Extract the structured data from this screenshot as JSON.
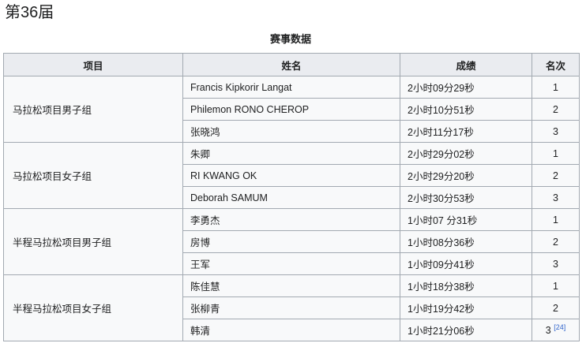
{
  "page_heading": "第36届",
  "table": {
    "caption": "赛事数据",
    "headers": [
      "项目",
      "姓名",
      "成绩",
      "名次"
    ],
    "groups": [
      {
        "event": "马拉松项目男子组",
        "rows": [
          {
            "name": "Francis Kipkorir Langat",
            "result": "2小时09分29秒",
            "rank": "1",
            "ref": ""
          },
          {
            "name": "Philemon RONO CHEROP",
            "result": "2小时10分51秒",
            "rank": "2",
            "ref": ""
          },
          {
            "name": "张晓鸿",
            "result": "2小时11分17秒",
            "rank": "3",
            "ref": ""
          }
        ]
      },
      {
        "event": "马拉松项目女子组",
        "rows": [
          {
            "name": "朱卿",
            "result": "2小时29分02秒",
            "rank": "1",
            "ref": ""
          },
          {
            "name": "RI KWANG OK",
            "result": "2小时29分20秒",
            "rank": "2",
            "ref": ""
          },
          {
            "name": "Deborah SAMUM",
            "result": "2小时30分53秒",
            "rank": "3",
            "ref": ""
          }
        ]
      },
      {
        "event": "半程马拉松项目男子组",
        "rows": [
          {
            "name": "李勇杰",
            "result": "1小时07 分31秒",
            "rank": "1",
            "ref": ""
          },
          {
            "name": "房博",
            "result": "1小时08分36秒",
            "rank": "2",
            "ref": ""
          },
          {
            "name": "王军",
            "result": "1小时09分41秒",
            "rank": "3",
            "ref": ""
          }
        ]
      },
      {
        "event": "半程马拉松项目女子组",
        "rows": [
          {
            "name": "陈佳慧",
            "result": "1小时18分38秒",
            "rank": "1",
            "ref": ""
          },
          {
            "name": "张柳青",
            "result": "1小时19分42秒",
            "rank": "2",
            "ref": ""
          },
          {
            "name": "韩清",
            "result": "1小时21分06秒",
            "rank": "3",
            "ref": "[24]"
          }
        ]
      }
    ]
  }
}
